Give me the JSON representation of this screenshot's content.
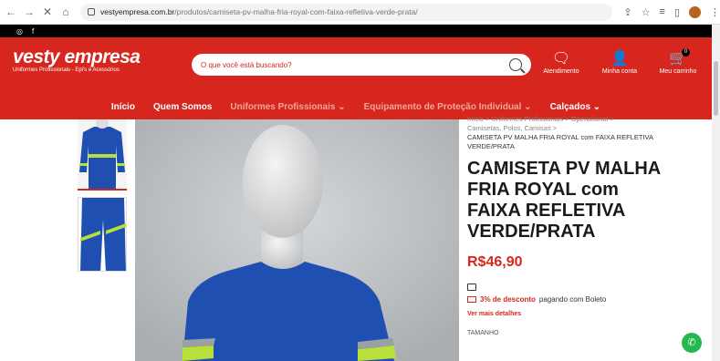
{
  "browser": {
    "url_host": "vestyempresa.com.br",
    "url_path": "/produtos/camiseta-pv-malha-fria-royal-com-faixa-refletiva-verde-prata/"
  },
  "topbar": {
    "instagram": "◎",
    "facebook": "f"
  },
  "header": {
    "logo_main": "vesty empresa",
    "logo_sub": "Uniformes Profissionais - Epi's e Acessórios",
    "search_placeholder": "O que você está buscando?",
    "service_label": "Atendimento",
    "account_label": "Minha conta",
    "cart_label": "Meu carrinho",
    "cart_count": "0"
  },
  "nav": {
    "items": [
      "Início",
      "Quem Somos",
      "Uniformes Profissionais ⌄",
      "Equipamento de Proteção Individual ⌄",
      "Calçados ⌄"
    ]
  },
  "product": {
    "breadcrumb_line1": "Início > Uniformes Profissionais > Operacional >",
    "breadcrumb_line2": "Camisetas, Polos, Camisas >",
    "breadcrumb_current": "CAMISETA PV MALHA FRIA ROYAL com FAIXA REFLETIVA VERDE/PRATA",
    "title": "CAMISETA PV MALHA FRIA ROYAL com FAIXA REFLETIVA VERDE/PRATA",
    "price": "R$46,90",
    "discount_strong": "3% de desconto",
    "discount_rest": "pagando com Boleto",
    "more_details": "Ver mais detalhes",
    "size_label": "TAMANHO"
  },
  "colors": {
    "brand": "#d7261e",
    "royal": "#1f4fb0",
    "reflective": "#b9e03a"
  }
}
